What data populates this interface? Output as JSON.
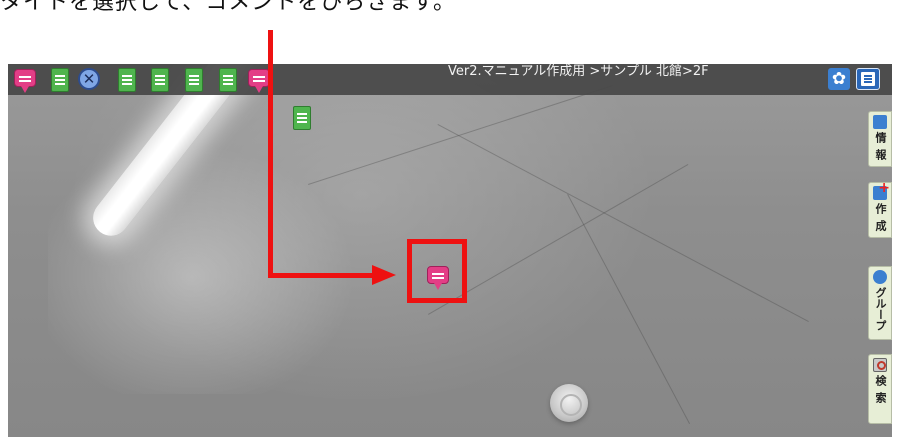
{
  "caption": {
    "text": "タイトを選択して、コメントをひらきます。"
  },
  "viewer": {
    "breadcrumb": "Ver2.マニュアル作成用 >サンプル 北館>2F",
    "toolbar_markers": [
      {
        "type": "comment",
        "icon": "comment-bubble-icon"
      },
      {
        "type": "note",
        "icon": "note-icon"
      },
      {
        "type": "close",
        "icon": "close-circle-icon",
        "glyph": "✕"
      },
      {
        "type": "note",
        "icon": "note-icon"
      },
      {
        "type": "note",
        "icon": "note-icon"
      },
      {
        "type": "note",
        "icon": "note-icon"
      },
      {
        "type": "note",
        "icon": "note-icon"
      },
      {
        "type": "comment",
        "icon": "comment-bubble-icon"
      }
    ],
    "settings": {
      "icon": "gear-icon",
      "glyph": "✿"
    },
    "info_panel": {
      "icon": "info-panel-icon"
    },
    "side_tabs": [
      {
        "label": "情報",
        "icon": "info-icon"
      },
      {
        "label": "作成",
        "icon": "create-icon"
      },
      {
        "label": "グループ",
        "icon": "group-icon"
      },
      {
        "label": "検索",
        "icon": "search-icon"
      }
    ],
    "scene_markers": [
      {
        "type": "note",
        "icon": "note-icon"
      },
      {
        "type": "comment",
        "icon": "comment-bubble-icon"
      }
    ]
  },
  "colors": {
    "annotation": "#ee1111",
    "note_marker": "#4fb54e",
    "comment_marker": "#e33e86",
    "toolbar_bg": "#464646"
  }
}
